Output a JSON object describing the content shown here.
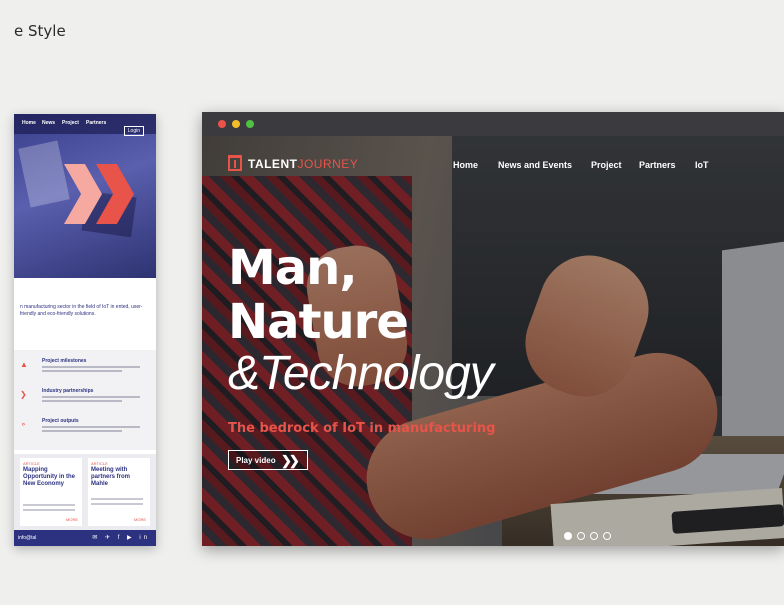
{
  "page": {
    "heading": "e Style"
  },
  "left_mockup": {
    "nav_items": [
      "Home",
      "News",
      "Project",
      "Partners"
    ],
    "hero_button": "Login",
    "intro_text": "n manufacturing sector in the field of IoT in ented, user-friendly and eco-friendly solutions.",
    "items": [
      {
        "icon": "▲",
        "title": "Project milestones"
      },
      {
        "icon": "❯",
        "title": "Industry partnerships"
      },
      {
        "icon": "⚬",
        "title": "Project outputs"
      }
    ],
    "cards": [
      {
        "tag": "ARTICLE",
        "title": "Mapping Opportunity in the New Economy",
        "more": "MORE"
      },
      {
        "tag": "ARTICLE",
        "title": "Meeting with partners from Mahle",
        "more": "MORE"
      }
    ],
    "footer_text": "info@tal",
    "footer_icons": "✉ ✈ f ▶ in"
  },
  "browser": {
    "brand_bold": "TALENT",
    "brand_light": "JOURNEY",
    "nav": [
      "Home",
      "News and Events",
      "Project",
      "Partners",
      "IoT"
    ],
    "hero": {
      "line1": "Man,",
      "line2": "Nature",
      "line3": "&Technology",
      "subhead": "The bedrock of IoT in manufacturing",
      "button_label": "Play video",
      "button_chevrons": "❯❯"
    },
    "carousel": {
      "count": 4,
      "active": 0
    }
  },
  "colors": {
    "accent": "#e8534a",
    "navy": "#2d3280",
    "traffic_red": "#ec5348",
    "traffic_yellow": "#f3bc2b",
    "traffic_green": "#4fc245"
  }
}
